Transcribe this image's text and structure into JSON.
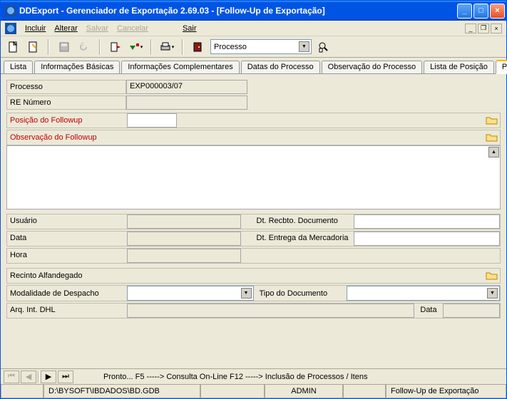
{
  "title": "DDExport - Gerenciador de Exportação 2.69.03 - [Follow-Up de Exportação]",
  "menu": {
    "incluir": "Incluir",
    "alterar": "Alterar",
    "salvar": "Salvar",
    "cancelar": "Cancelar",
    "sair": "Sair"
  },
  "toolbar": {
    "combo_label": "Processo"
  },
  "tabs": {
    "lista": "Lista",
    "basicas": "Informações Básicas",
    "compl": "Informações Complementares",
    "datas": "Datas do Processo",
    "obs": "Observação do Processo",
    "listapos": "Lista de Posição",
    "posicao": "Posição"
  },
  "fields": {
    "processo_lbl": "Processo",
    "processo_val": "EXP000003/07",
    "re_lbl": "RE Número",
    "re_val": "",
    "posfollow_lbl": "Posição do Followup",
    "posfollow_val": "",
    "obsfollow_lbl": "Observação do Followup",
    "obsfollow_val": "",
    "usuario_lbl": "Usuário",
    "usuario_val": "",
    "dtrec_lbl": "Dt. Recbto. Documento",
    "dtrec_val": "",
    "data_lbl": "Data",
    "data_val": "",
    "dtent_lbl": "Dt. Entrega da Mercadoria",
    "dtent_val": "",
    "hora_lbl": "Hora",
    "hora_val": "",
    "recalf_lbl": "Recinto Alfandegado",
    "recalf_val": "",
    "moddesp_lbl": "Modalidade de Despacho",
    "moddesp_val": "",
    "tipodoc_lbl": "Tipo do Documento",
    "tipodoc_val": "",
    "arqdhl_lbl": "Arq. Int. DHL",
    "arqdhl_val": "",
    "data2_lbl": "Data",
    "data2_val": ""
  },
  "nav": {
    "hint": "Pronto...    F5  -----> Consulta On-Line  F12 -----> Inclusão de Processos / Itens"
  },
  "status": {
    "path": "D:\\BYSOFT\\IBDADOS\\BD.GDB",
    "user": "ADMIN",
    "module": "Follow-Up de Exportação"
  }
}
